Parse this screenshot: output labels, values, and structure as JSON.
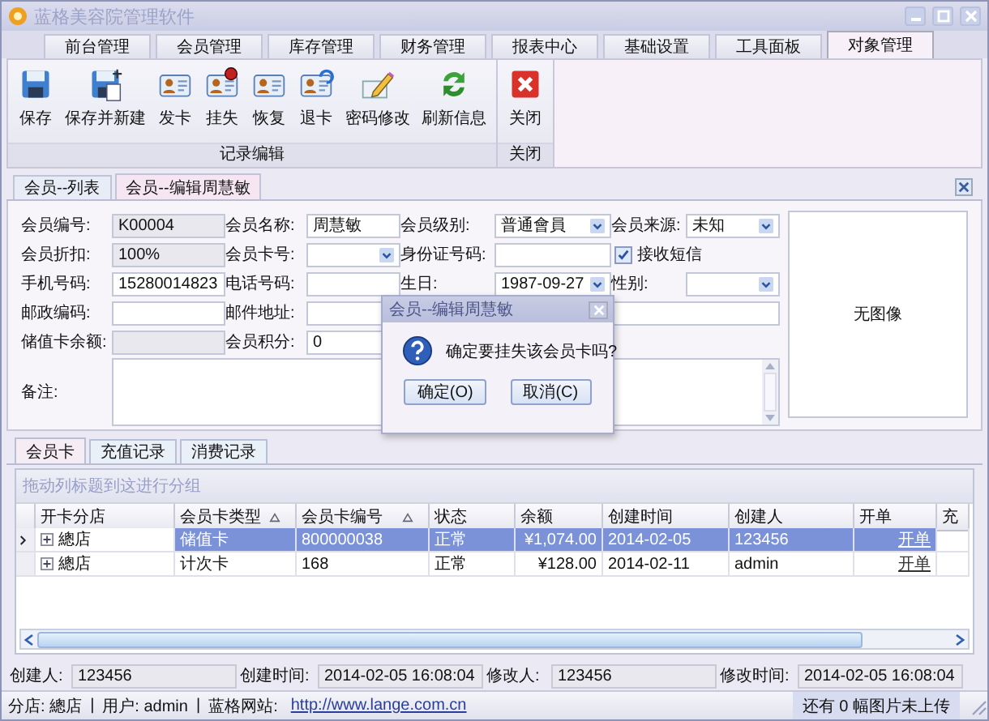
{
  "window": {
    "title": "蓝格美容院管理软件"
  },
  "menu_tabs": [
    {
      "label": "前台管理",
      "selected": false
    },
    {
      "label": "会员管理",
      "selected": false
    },
    {
      "label": "库存管理",
      "selected": false
    },
    {
      "label": "财务管理",
      "selected": false
    },
    {
      "label": "报表中心",
      "selected": false
    },
    {
      "label": "基础设置",
      "selected": false
    },
    {
      "label": "工具面板",
      "selected": false
    },
    {
      "label": "对象管理",
      "selected": true
    }
  ],
  "ribbon": {
    "groups": [
      {
        "label": "记录编辑",
        "buttons": [
          {
            "label": "保存",
            "kind": "save"
          },
          {
            "label": "保存并新建",
            "kind": "save-new"
          },
          {
            "label": "发卡",
            "kind": "card"
          },
          {
            "label": "挂失",
            "kind": "card-lost"
          },
          {
            "label": "恢复",
            "kind": "card"
          },
          {
            "label": "退卡",
            "kind": "card-return"
          },
          {
            "label": "密码修改",
            "kind": "pencil"
          },
          {
            "label": "刷新信息",
            "kind": "refresh"
          }
        ]
      },
      {
        "label": "关闭",
        "buttons": [
          {
            "label": "关闭",
            "kind": "close"
          }
        ]
      }
    ]
  },
  "doc_tabs": [
    {
      "label": "会员--列表",
      "selected": false
    },
    {
      "label": "会员--编辑周慧敏",
      "selected": true
    }
  ],
  "form": {
    "rows": [
      [
        {
          "label": "会员编号:",
          "value": "K00004",
          "kind": "text",
          "readonly": true
        },
        {
          "label": "会员名称:",
          "value": "周慧敏",
          "kind": "text",
          "readonly": false
        },
        {
          "label": "会员级别:",
          "value": "普通會員",
          "kind": "dropdown"
        },
        {
          "label": "会员来源:",
          "value": "未知",
          "kind": "dropdown"
        }
      ],
      [
        {
          "label": "会员折扣:",
          "value": "100%",
          "kind": "text",
          "readonly": true
        },
        {
          "label": "会员卡号:",
          "kind": "dropdown"
        },
        {
          "label": "身份证号码:",
          "kind": "text",
          "readonly": false
        },
        {
          "label": "接收短信",
          "kind": "checkbox",
          "checked": true
        }
      ],
      [
        {
          "label": "手机号码:",
          "value": "15280014823",
          "kind": "text",
          "readonly": false
        },
        {
          "label": "电话号码:",
          "kind": "text",
          "readonly": false
        },
        {
          "label": "生日:",
          "value": "1987-09-27",
          "kind": "dropdown"
        },
        {
          "label": "性别:",
          "kind": "dropdown"
        }
      ],
      [
        {
          "label": "邮政编码:",
          "kind": "text",
          "readonly": false
        },
        {
          "label": "邮件地址:",
          "kind": "text",
          "readonly": false,
          "wide": true
        }
      ],
      [
        {
          "label": "储值卡余额:",
          "kind": "text",
          "readonly": true
        },
        {
          "label": "会员积分:",
          "value": "0",
          "kind": "text",
          "readonly": false
        }
      ],
      [
        {
          "label": "备注:",
          "kind": "memo"
        }
      ]
    ],
    "image_placeholder": "无图像"
  },
  "dialog": {
    "title": "会员--编辑周慧敏",
    "message": "确定要挂失该会员卡吗?",
    "buttons": [
      "确定(O)",
      "取消(C)"
    ]
  },
  "sub_tabs": [
    {
      "label": "会员卡",
      "selected": true
    },
    {
      "label": "充值记录",
      "selected": false
    },
    {
      "label": "消费记录",
      "selected": false
    }
  ],
  "grid": {
    "group_hint": "拖动列标题到这进行分组",
    "columns": [
      {
        "label": "开卡分店",
        "sorted": false,
        "kind": "tree"
      },
      {
        "label": "会员卡类型",
        "sorted": true,
        "kind": "text"
      },
      {
        "label": "会员卡编号",
        "sorted": true,
        "kind": "text"
      },
      {
        "label": "状态",
        "sorted": false,
        "kind": "text"
      },
      {
        "label": "余额",
        "sorted": false,
        "kind": "money"
      },
      {
        "label": "创建时间",
        "sorted": false,
        "kind": "text"
      },
      {
        "label": "创建人",
        "sorted": false,
        "kind": "text"
      },
      {
        "label": "开单",
        "sorted": false,
        "kind": "link"
      },
      {
        "label": "充",
        "sorted": false,
        "kind": "text"
      }
    ],
    "rows": [
      {
        "selected": true,
        "cells": [
          "總店",
          "储值卡",
          "800000038",
          "正常",
          "¥1,074.00",
          "2014-02-05",
          "123456",
          "开单"
        ]
      },
      {
        "selected": false,
        "cells": [
          "總店",
          "计次卡",
          "168",
          "正常",
          "¥128.00",
          "2014-02-11",
          "admin",
          "开单"
        ]
      }
    ]
  },
  "audit": [
    {
      "label": "创建人:",
      "value": "123456"
    },
    {
      "label": "创建时间:",
      "value": "2014-02-05 16:08:04"
    },
    {
      "label": "修改人:",
      "value": "123456"
    },
    {
      "label": "修改时间:",
      "value": "2014-02-05 16:08:04"
    }
  ],
  "status_bar": {
    "segments": [
      "分店: 總店",
      "|",
      "用户: admin",
      "|",
      "蓝格网站:"
    ],
    "link": "http://www.lange.com.cn",
    "notice": "还有 0 幅图片未上传"
  }
}
